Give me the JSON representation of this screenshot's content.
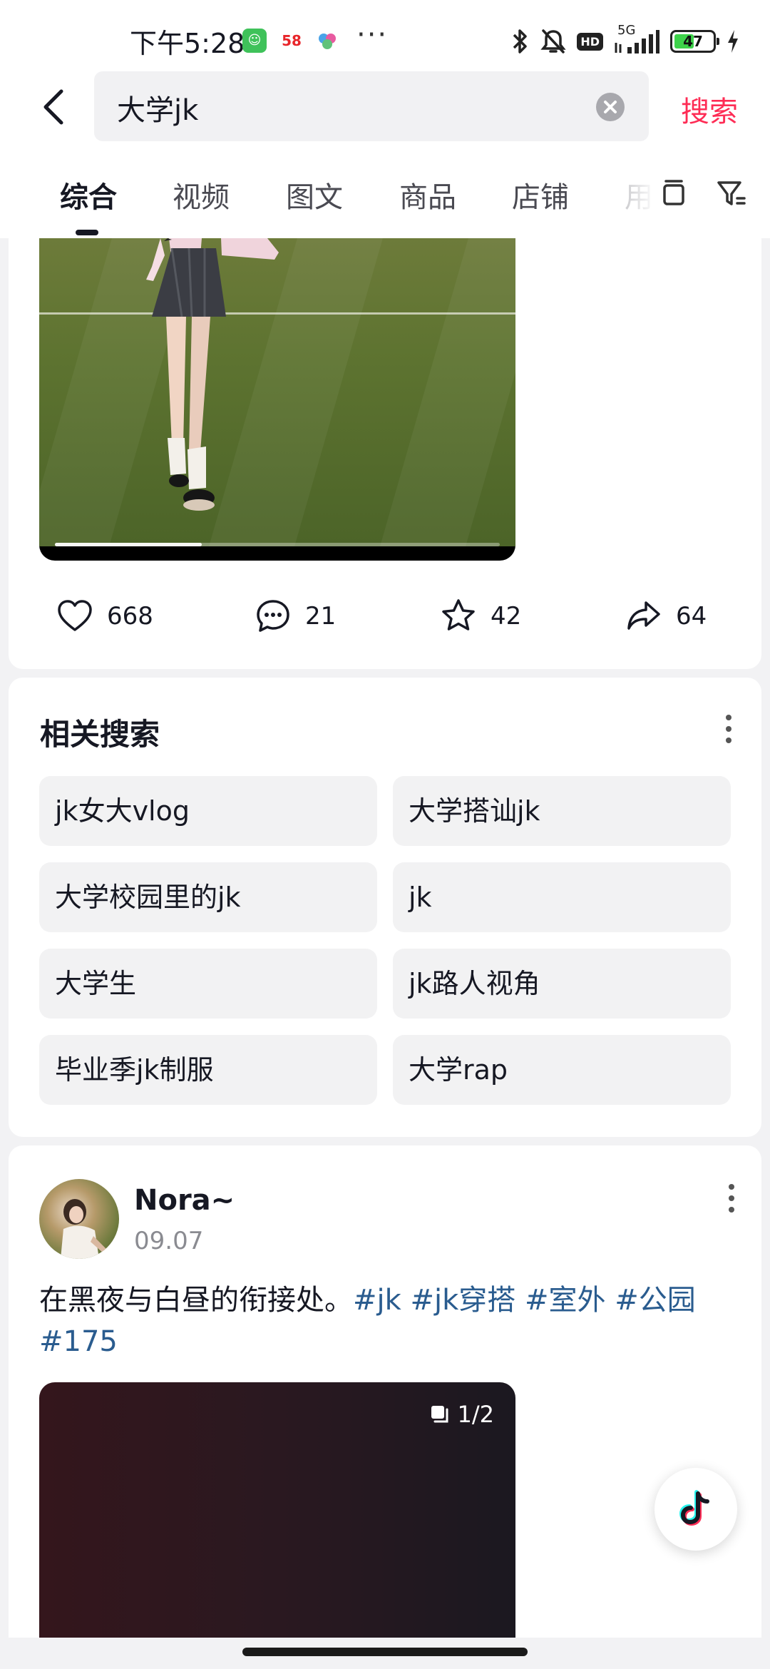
{
  "status_bar": {
    "time": "下午5:28",
    "app_badge_58": "58",
    "network": "5G",
    "hd": "HD",
    "battery": "47"
  },
  "search": {
    "query": "大学jk",
    "submit_label": "搜索"
  },
  "tabs": [
    {
      "label": "综合"
    },
    {
      "label": "视频"
    },
    {
      "label": "图文"
    },
    {
      "label": "商品"
    },
    {
      "label": "店铺"
    },
    {
      "label": "用"
    }
  ],
  "video_post": {
    "progress": 0.33,
    "likes": "668",
    "comments": "21",
    "favorites": "42",
    "shares": "64"
  },
  "related": {
    "title": "相关搜索",
    "items": [
      "jk女大vlog",
      "大学搭讪jk",
      "大学校园里的jk",
      "jk",
      "大学生",
      "jk路人视角",
      "毕业季jk制服",
      "大学rap"
    ]
  },
  "post": {
    "author": "Nora~",
    "date": "09.07",
    "text": "在黑夜与白昼的衔接处。",
    "hashtags": [
      "#jk",
      "#jk穿搭",
      "#室外",
      "#公园",
      "#175"
    ],
    "image_count": "1/2"
  },
  "colors": {
    "accent": "#fe2c55",
    "hashtag": "#2a5c8f",
    "chip_bg": "#f2f2f3"
  }
}
